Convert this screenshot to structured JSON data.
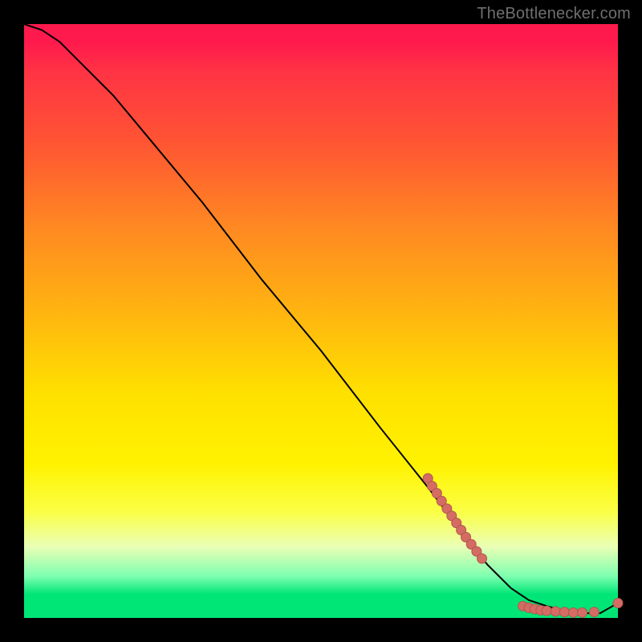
{
  "watermark": "TheBottlenecker.com",
  "colors": {
    "curve": "#000000",
    "marker_fill": "#d56c63",
    "marker_stroke": "#b0564e"
  },
  "chart_data": {
    "type": "line",
    "title": "",
    "xlabel": "",
    "ylabel": "",
    "xlim": [
      0,
      100
    ],
    "ylim": [
      0,
      100
    ],
    "curve": {
      "x": [
        0,
        3,
        6,
        10,
        15,
        20,
        30,
        40,
        50,
        60,
        68,
        74,
        78,
        82,
        85,
        88,
        91,
        94,
        97,
        100
      ],
      "y": [
        100,
        99,
        97,
        93,
        88,
        82,
        70,
        57,
        45,
        32,
        22,
        14,
        9,
        5,
        3,
        2,
        1.2,
        0.8,
        0.8,
        2.5
      ]
    },
    "markers": [
      {
        "x": 68,
        "y": 23.5
      },
      {
        "x": 68.7,
        "y": 22.2
      },
      {
        "x": 69.5,
        "y": 21.0
      },
      {
        "x": 70.3,
        "y": 19.7
      },
      {
        "x": 71.2,
        "y": 18.4
      },
      {
        "x": 72.0,
        "y": 17.2
      },
      {
        "x": 72.8,
        "y": 16.0
      },
      {
        "x": 73.6,
        "y": 14.8
      },
      {
        "x": 74.4,
        "y": 13.6
      },
      {
        "x": 75.3,
        "y": 12.4
      },
      {
        "x": 76.2,
        "y": 11.2
      },
      {
        "x": 77.1,
        "y": 10.0
      },
      {
        "x": 84.0,
        "y": 2.0
      },
      {
        "x": 85.0,
        "y": 1.7
      },
      {
        "x": 86.0,
        "y": 1.5
      },
      {
        "x": 87.0,
        "y": 1.3
      },
      {
        "x": 88.0,
        "y": 1.2
      },
      {
        "x": 89.5,
        "y": 1.1
      },
      {
        "x": 91.0,
        "y": 1.0
      },
      {
        "x": 92.5,
        "y": 0.9
      },
      {
        "x": 94.0,
        "y": 0.9
      },
      {
        "x": 96.0,
        "y": 1.0
      },
      {
        "x": 100.0,
        "y": 2.5
      }
    ],
    "marker_radius": 6
  }
}
